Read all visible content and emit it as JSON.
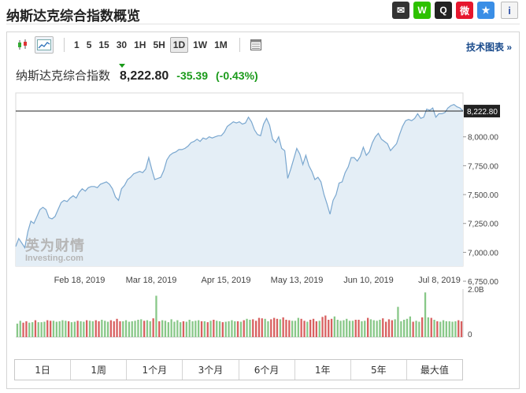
{
  "page": {
    "title": "纳斯达克综合指数概览",
    "info_icon": "i"
  },
  "share": [
    {
      "name": "mail-icon",
      "color": "#333333",
      "glyph": "✉"
    },
    {
      "name": "wechat-icon",
      "color": "#2dc100",
      "glyph": "W"
    },
    {
      "name": "qq-icon",
      "color": "#222222",
      "glyph": "Q"
    },
    {
      "name": "weibo-icon",
      "color": "#e6162d",
      "glyph": "微"
    },
    {
      "name": "qzone-icon",
      "color": "#3a8ee6",
      "glyph": "★"
    }
  ],
  "toolbar": {
    "timeframes": [
      "1",
      "5",
      "15",
      "30",
      "1H",
      "5H",
      "1D",
      "1W",
      "1M"
    ],
    "selected_timeframe": "1D",
    "tech_chart_label": "技术图表 »"
  },
  "quote": {
    "name": "纳斯达克综合指数",
    "price": "8,222.80",
    "change": "-35.39",
    "change_pct": "(-0.43%)",
    "change_color": "#1a9a1a"
  },
  "watermark": {
    "cn": "英为财情",
    "en": "Investing.com"
  },
  "ranges": [
    "1日",
    "1周",
    "1个月",
    "3个月",
    "6个月",
    "1年",
    "5年",
    "最大值"
  ],
  "chart_data": {
    "type": "area",
    "title": "",
    "xlabel": "",
    "ylabel": "",
    "x_tick_labels": [
      "Feb 18, 2019",
      "Mar 18, 2019",
      "Apr 15, 2019",
      "May 13, 2019",
      "Jun 10, 2019",
      "Jul 8, 2019"
    ],
    "y_tick_labels": [
      "8,000.00",
      "7,750.00",
      "7,500.00",
      "7,250.00",
      "7,000.00",
      "6,750.00"
    ],
    "y_ticks": [
      8000,
      7750,
      7500,
      7250,
      7000,
      6750
    ],
    "ylim": [
      6880,
      8380
    ],
    "last_price_label": "8,222.80",
    "last_price": 8222.8,
    "line_color": "#7aa7cf",
    "fill_color": "#e4eef6",
    "series": [
      {
        "values": [
          7050,
          7120,
          7080,
          7040,
          7180,
          7270,
          7250,
          7310,
          7370,
          7390,
          7370,
          7300,
          7290,
          7310,
          7370,
          7430,
          7450,
          7440,
          7470,
          7490,
          7470,
          7520,
          7550,
          7530,
          7560,
          7570,
          7570,
          7560,
          7590,
          7600,
          7610,
          7590,
          7550,
          7480,
          7450,
          7550,
          7580,
          7630,
          7650,
          7680,
          7690,
          7700,
          7690,
          7720,
          7820,
          7720,
          7630,
          7640,
          7650,
          7710,
          7800,
          7840,
          7860,
          7870,
          7890,
          7890,
          7900,
          7920,
          7950,
          7960,
          7980,
          7960,
          7990,
          7980,
          8000,
          7990,
          8000,
          8010,
          8010,
          8040,
          8090,
          8110,
          8130,
          8120,
          8130,
          8110,
          8120,
          8170,
          8130,
          8060,
          8020,
          8010,
          8110,
          8160,
          8100,
          7980,
          7950,
          8000,
          7900,
          7880,
          7640,
          7720,
          7810,
          7900,
          7850,
          7760,
          7840,
          7750,
          7700,
          7630,
          7650,
          7610,
          7500,
          7420,
          7330,
          7450,
          7500,
          7600,
          7610,
          7690,
          7740,
          7820,
          7820,
          7790,
          7830,
          7910,
          7840,
          7870,
          7950,
          8000,
          8030,
          7980,
          7960,
          7940,
          7880,
          7910,
          7940,
          8020,
          8090,
          8140,
          8150,
          8140,
          8160,
          8200,
          8160,
          8170,
          8240,
          8230,
          8250,
          8170,
          8200,
          8200,
          8210,
          8250,
          8270,
          8280,
          8260,
          8250,
          8222.8
        ]
      }
    ],
    "volume": {
      "y_tick_labels": [
        "2.0B",
        "0"
      ],
      "bars": [
        0.28,
        0.34,
        0.3,
        0.33,
        0.3,
        0.31,
        0.35,
        0.31,
        0.31,
        0.32,
        0.35,
        0.34,
        0.34,
        0.32,
        0.33,
        0.35,
        0.34,
        0.33,
        0.31,
        0.32,
        0.34,
        0.33,
        0.32,
        0.35,
        0.34,
        0.33,
        0.35,
        0.33,
        0.36,
        0.34,
        0.32,
        0.35,
        0.33,
        0.38,
        0.33,
        0.33,
        0.35,
        0.32,
        0.33,
        0.34,
        0.36,
        0.37,
        0.34,
        0.35,
        0.33,
        0.39,
        0.86,
        0.33,
        0.35,
        0.34,
        0.31,
        0.37,
        0.32,
        0.35,
        0.31,
        0.33,
        0.32,
        0.36,
        0.33,
        0.34,
        0.35,
        0.33,
        0.33,
        0.31,
        0.34,
        0.36,
        0.34,
        0.33,
        0.31,
        0.32,
        0.33,
        0.35,
        0.33,
        0.33,
        0.32,
        0.35,
        0.38,
        0.36,
        0.37,
        0.34,
        0.4,
        0.39,
        0.38,
        0.33,
        0.37,
        0.4,
        0.38,
        0.37,
        0.41,
        0.36,
        0.35,
        0.34,
        0.34,
        0.4,
        0.38,
        0.34,
        0.32,
        0.36,
        0.38,
        0.33,
        0.34,
        0.42,
        0.45,
        0.36,
        0.38,
        0.43,
        0.36,
        0.34,
        0.35,
        0.38,
        0.34,
        0.34,
        0.36,
        0.36,
        0.33,
        0.34,
        0.4,
        0.37,
        0.35,
        0.34,
        0.36,
        0.39,
        0.32,
        0.37,
        0.35,
        0.37,
        0.63,
        0.33,
        0.36,
        0.38,
        0.43,
        0.32,
        0.34,
        0.32,
        0.41,
        0.93,
        0.41,
        0.4,
        0.36,
        0.33,
        0.32,
        0.35,
        0.33,
        0.33,
        0.32,
        0.33,
        0.35,
        0.33
      ],
      "colors": [
        "g",
        "g",
        "r",
        "r",
        "g",
        "g",
        "r",
        "g",
        "g",
        "g",
        "r",
        "r",
        "g",
        "g",
        "g",
        "g",
        "g",
        "r",
        "g",
        "g",
        "r",
        "g",
        "g",
        "r",
        "g",
        "g",
        "r",
        "r",
        "g",
        "g",
        "g",
        "r",
        "r",
        "r",
        "r",
        "g",
        "g",
        "g",
        "g",
        "g",
        "g",
        "g",
        "r",
        "g",
        "g",
        "r",
        "g",
        "r",
        "g",
        "g",
        "g",
        "g",
        "g",
        "g",
        "g",
        "r",
        "g",
        "g",
        "g",
        "g",
        "g",
        "r",
        "g",
        "r",
        "g",
        "r",
        "g",
        "g",
        "r",
        "g",
        "g",
        "g",
        "g",
        "r",
        "g",
        "r",
        "g",
        "g",
        "r",
        "r",
        "r",
        "r",
        "g",
        "g",
        "r",
        "r",
        "r",
        "g",
        "r",
        "r",
        "r",
        "g",
        "g",
        "g",
        "r",
        "r",
        "g",
        "r",
        "r",
        "r",
        "g",
        "r",
        "r",
        "r",
        "r",
        "g",
        "g",
        "g",
        "g",
        "g",
        "g",
        "g",
        "r",
        "r",
        "g",
        "g",
        "r",
        "g",
        "g",
        "g",
        "g",
        "r",
        "r",
        "r",
        "r",
        "g",
        "g",
        "g",
        "g",
        "g",
        "g",
        "r",
        "g",
        "g",
        "r",
        "g",
        "g",
        "r",
        "g",
        "r",
        "g",
        "g",
        "g",
        "g",
        "g",
        "g",
        "r",
        "r",
        "r",
        "r"
      ],
      "green_color": "#88c888",
      "red_color": "#d86060"
    }
  }
}
